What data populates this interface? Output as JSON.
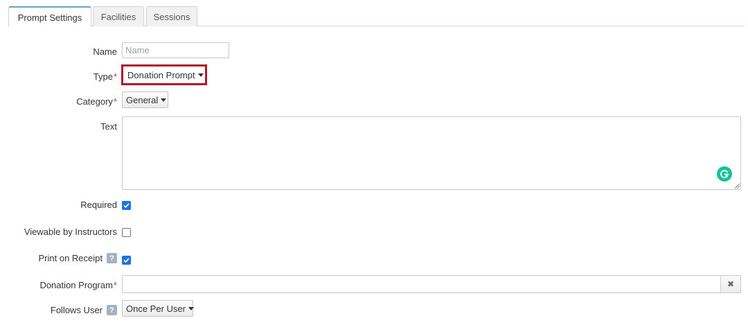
{
  "tabs": [
    {
      "label": "Prompt Settings",
      "active": true
    },
    {
      "label": "Facilities",
      "active": false
    },
    {
      "label": "Sessions",
      "active": false
    }
  ],
  "form": {
    "name": {
      "label": "Name",
      "value": "",
      "placeholder": "Name"
    },
    "type": {
      "label": "Type",
      "required_mark": "*",
      "value": "Donation Prompt"
    },
    "category": {
      "label": "Category",
      "required_mark": "*",
      "value": "General"
    },
    "text": {
      "label": "Text",
      "value": ""
    },
    "required": {
      "label": "Required",
      "checked": true
    },
    "viewable_by_instructors": {
      "label": "Viewable by Instructors",
      "checked": false
    },
    "print_on_receipt": {
      "label": "Print on Receipt",
      "help": "?",
      "checked": true
    },
    "donation_program": {
      "label": "Donation Program",
      "required_mark": "*",
      "value": "",
      "clear_icon": "✖"
    },
    "follows_user": {
      "label": "Follows User",
      "help": "?",
      "value": "Once Per User"
    }
  },
  "colors": {
    "highlight": "#b0152b",
    "checkbox": "#1a73e8",
    "grammarly": "#15c39a",
    "required_mark": "#c0392b"
  },
  "icons": {
    "dropdown": "caret-down-icon",
    "check": "checkmark-icon",
    "help": "question-icon",
    "clear": "clear-icon",
    "grammarly": "grammarly-icon"
  }
}
